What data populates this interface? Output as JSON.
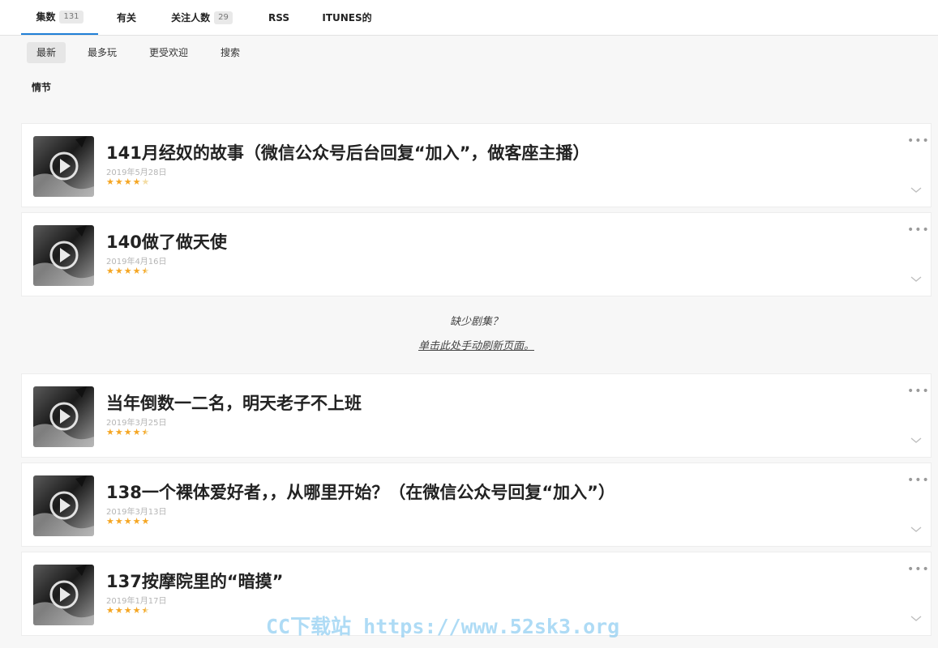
{
  "tabs": [
    {
      "label": "集数",
      "badge": "131"
    },
    {
      "label": "有关"
    },
    {
      "label": "关注人数",
      "badge": "29"
    },
    {
      "label": "RSS"
    },
    {
      "label": "ITUNES的"
    }
  ],
  "subtabs": [
    "最新",
    "最多玩",
    "更受欢迎",
    "搜索"
  ],
  "section_label": "情节",
  "episodes": [
    {
      "title": "141月经奴的故事（微信公众号后台回复“加入”，做客座主播）",
      "date": "2019年5月28日",
      "rating": 4
    },
    {
      "title": "140做了做天使",
      "date": "2019年4月16日",
      "rating": 4.5
    },
    {
      "title": "当年倒数一二名，明天老子不上班",
      "date": "2019年3月25日",
      "rating": 4.5
    },
    {
      "title": "138一个裸体爱好者，，从哪里开始？（在微信公众号回复“加入”）",
      "date": "2019年3月13日",
      "rating": 5
    },
    {
      "title": "137按摩院里的“暗摸”",
      "date": "2019年1月17日",
      "rating": 4.5
    }
  ],
  "missing": {
    "question": "缺少剧集？",
    "link": "单击此处手动刷新页面。"
  },
  "more_glyph": "•••",
  "watermark": "CC下载站 https://www.52sk3.org",
  "colors": {
    "accent": "#1f7fd6",
    "star": "#f5a623",
    "star_empty": "#f3dca4"
  }
}
